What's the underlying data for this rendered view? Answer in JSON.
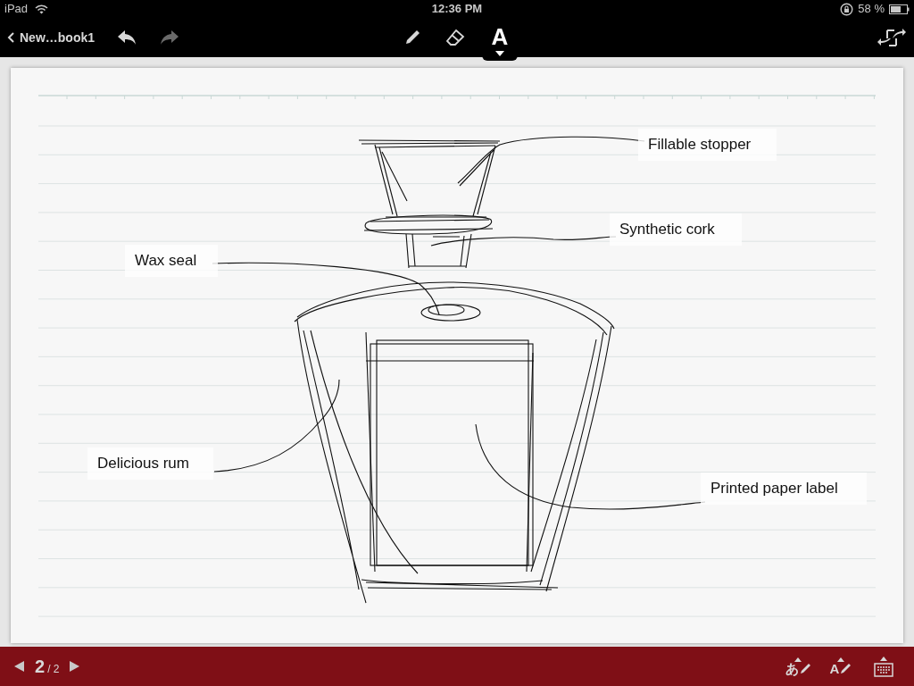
{
  "status_bar": {
    "carrier": "iPad",
    "time": "12:36 PM",
    "battery": "58 %"
  },
  "toolbar": {
    "back": "New…book1",
    "tools": [
      {
        "kind": "pen",
        "selected": false
      },
      {
        "kind": "eraser",
        "selected": false
      },
      {
        "kind": "text",
        "label": "A",
        "selected": true
      }
    ]
  },
  "annotations": [
    {
      "text": "Fillable stopper"
    },
    {
      "text": "Synthetic cork"
    },
    {
      "text": "Wax seal"
    },
    {
      "text": "Delicious rum"
    },
    {
      "text": "Printed paper label"
    }
  ],
  "pager": {
    "current": "2",
    "total": "/ 2"
  },
  "input_tools": [
    {
      "kind": "handwriting",
      "label": "あ"
    },
    {
      "kind": "handwriting",
      "label": "A"
    },
    {
      "kind": "keyboard"
    }
  ]
}
